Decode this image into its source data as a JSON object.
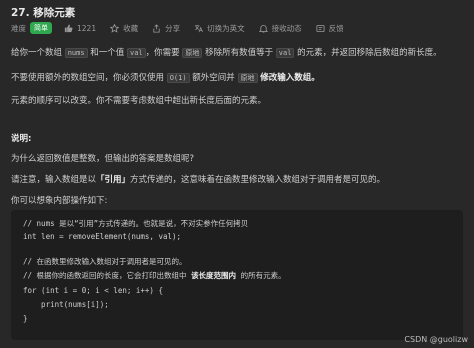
{
  "problem": {
    "title": "27. 移除元素",
    "difficulty_label": "难度",
    "difficulty": "简单",
    "likes": "1221",
    "favorite": "收藏",
    "share": "分享",
    "switch_lang": "切换为英文",
    "notifications": "接收动态",
    "feedback": "反馈"
  },
  "description": {
    "line1_a": "给你一个数组",
    "line1_code1": "nums",
    "line1_b": "和一个值",
    "line1_code2": "val",
    "line1_c": "，你需要",
    "line1_code3": "原地",
    "line1_d": "移除所有数值等于",
    "line1_code4": "val",
    "line1_e": "的元素，并返回移除后数组的新长度。",
    "line2_a": "不要使用额外的数组空间，你必须仅使用",
    "line2_code": "O(1)",
    "line2_b": "额外空间并",
    "line2_code2": "原地",
    "line2_c": "修改输入数组。",
    "line3": "元素的顺序可以改变。你不需要考虑数组中超出新长度后面的元素。",
    "explain_title": "说明:",
    "explain_q": "为什么返回数值是整数，但输出的答案是数组呢?",
    "explain_a_a": "请注意，输入数组是以",
    "explain_a_b": "「引用」",
    "explain_a_c": "方式传递的，这意味着在函数里修改输入数组对于调用者是可见的。",
    "explain_b": "你可以想象内部操作如下:"
  },
  "code": {
    "l1": "// nums 是以“引用”方式传递的。也就是说，不对实参作任何拷贝",
    "l2": "int len = removeElement(nums, val);",
    "l3": "// 在函数里修改输入数组对于调用者是可见的。",
    "l4a": "// 根据你的函数返回的长度，它会打印出数组中 ",
    "l4b": "该长度范围内",
    "l4c": " 的所有元素。",
    "l5": "for (int i = 0; i < len; i++) {",
    "l6": "    print(nums[i]);",
    "l7": "}"
  },
  "watermark": "CSDN @guolizw",
  "colors": {
    "easy": "#2fa84f",
    "background": "#282828",
    "code_bg": "#1e1e1e"
  }
}
